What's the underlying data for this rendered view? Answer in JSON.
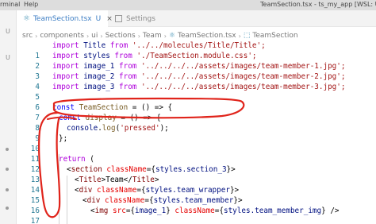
{
  "menu": {
    "terminal_label": "rminal",
    "help_label": "Help"
  },
  "window": {
    "title": "TeamSection.tsx - ts_my_app [WSL: Ubuntu"
  },
  "tabs": [
    {
      "label": "TeamSection.tsx",
      "status": "U",
      "close": "×",
      "icon": "react-icon",
      "active": true
    },
    {
      "label": "Settings",
      "icon": "settings-icon",
      "active": false
    }
  ],
  "left_strip": {
    "u_marks": [
      "U",
      "U"
    ]
  },
  "breadcrumb": [
    "src",
    "components",
    "ui",
    "Sections",
    "Team",
    "TeamSection.tsx",
    "TeamSection"
  ],
  "editor": {
    "lines": [
      {
        "n": "1"
      },
      {
        "n": "2"
      },
      {
        "n": "3"
      },
      {
        "n": "4"
      },
      {
        "n": "5"
      },
      {
        "n": "6"
      },
      {
        "n": "7"
      },
      {
        "n": "8"
      },
      {
        "n": "9"
      },
      {
        "n": "10"
      },
      {
        "n": "11"
      },
      {
        "n": "12"
      },
      {
        "n": "13"
      },
      {
        "n": "14"
      },
      {
        "n": "15"
      },
      {
        "n": "16"
      },
      {
        "n": "17"
      }
    ],
    "tokens": {
      "import": "import",
      "from": "from",
      "const": "const",
      "return": "return",
      "title": "Title",
      "title_path": "'../../molecules/Title/Title';",
      "styles": "styles",
      "styles_path": "'./TeamSection.module.css';",
      "image_1": "image_1",
      "image_1_path": "'../../../../assets/images/team-member-1.jpg';",
      "image_2": "image_2",
      "image_2_path": "'../../../../assets/images/team-member-2.jpg';",
      "image_3": "image_3",
      "image_3_path": "'../../../../assets/images/team-member-3.jpg';",
      "team_section": "TeamSection",
      "arrow_open": " = () => {",
      "display": "display",
      "display_rest": " = () => {",
      "console": "console",
      "log": "log",
      "pressed": "'pressed'",
      "paren_end": ");",
      "close_semi": "};",
      "close_brace": "}",
      "return_paren": " (",
      "section": "section",
      "classname": "className",
      "section_3": "styles.section_3",
      "title_tag": "Title",
      "team_text": "Team",
      "div": "div",
      "team_wrapper": "styles.team_wrapper",
      "team_member": "styles.team_member",
      "img": "img",
      "src": "src",
      "image_1_ref": "image_1",
      "team_member_img": "styles.team_member_img"
    }
  },
  "colors": {
    "annotation": "#e0241b",
    "keyword_import": "#af00db",
    "keyword_const": "#0000ff",
    "string": "#a31515",
    "variable": "#001080",
    "function": "#795e26",
    "tag": "#800000",
    "attribute": "#e50000",
    "line_number": "#237893"
  }
}
